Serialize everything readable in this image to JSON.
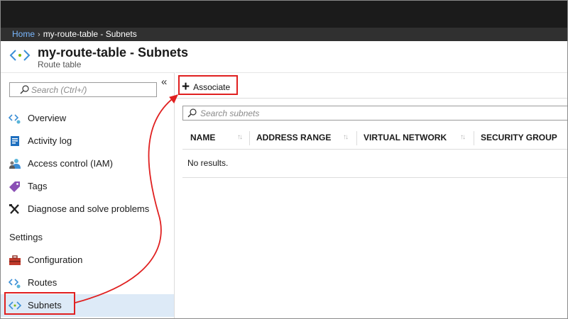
{
  "breadcrumb": {
    "home": "Home",
    "separator": "›",
    "current": "my-route-table - Subnets"
  },
  "page": {
    "title": "my-route-table - Subnets",
    "subtitle": "Route table",
    "icon": "route-table-icon"
  },
  "sidebar": {
    "search_placeholder": "Search (Ctrl+/)",
    "collapse_glyph": "«",
    "items": [
      {
        "label": "Overview",
        "icon": "overview-icon"
      },
      {
        "label": "Activity log",
        "icon": "activity-log-icon"
      },
      {
        "label": "Access control (IAM)",
        "icon": "iam-icon"
      },
      {
        "label": "Tags",
        "icon": "tag-icon"
      },
      {
        "label": "Diagnose and solve problems",
        "icon": "wrench-icon"
      }
    ],
    "settings_header": "Settings",
    "settings_items": [
      {
        "label": "Configuration",
        "icon": "toolbox-icon"
      },
      {
        "label": "Routes",
        "icon": "routes-icon"
      },
      {
        "label": "Subnets",
        "icon": "subnets-icon",
        "selected": true
      }
    ]
  },
  "toolbar": {
    "associate_label": "Associate",
    "associate_glyph": "+"
  },
  "grid": {
    "search_placeholder": "Search subnets",
    "columns": [
      "NAME",
      "ADDRESS RANGE",
      "VIRTUAL NETWORK",
      "SECURITY GROUP"
    ],
    "sort_glyph": "↑↓",
    "empty_text": "No results."
  },
  "colors": {
    "highlight": "#e02020",
    "selected_bg": "#ddeaf7",
    "link": "#7ab8ff",
    "header_bg": "#1b1b1b"
  }
}
